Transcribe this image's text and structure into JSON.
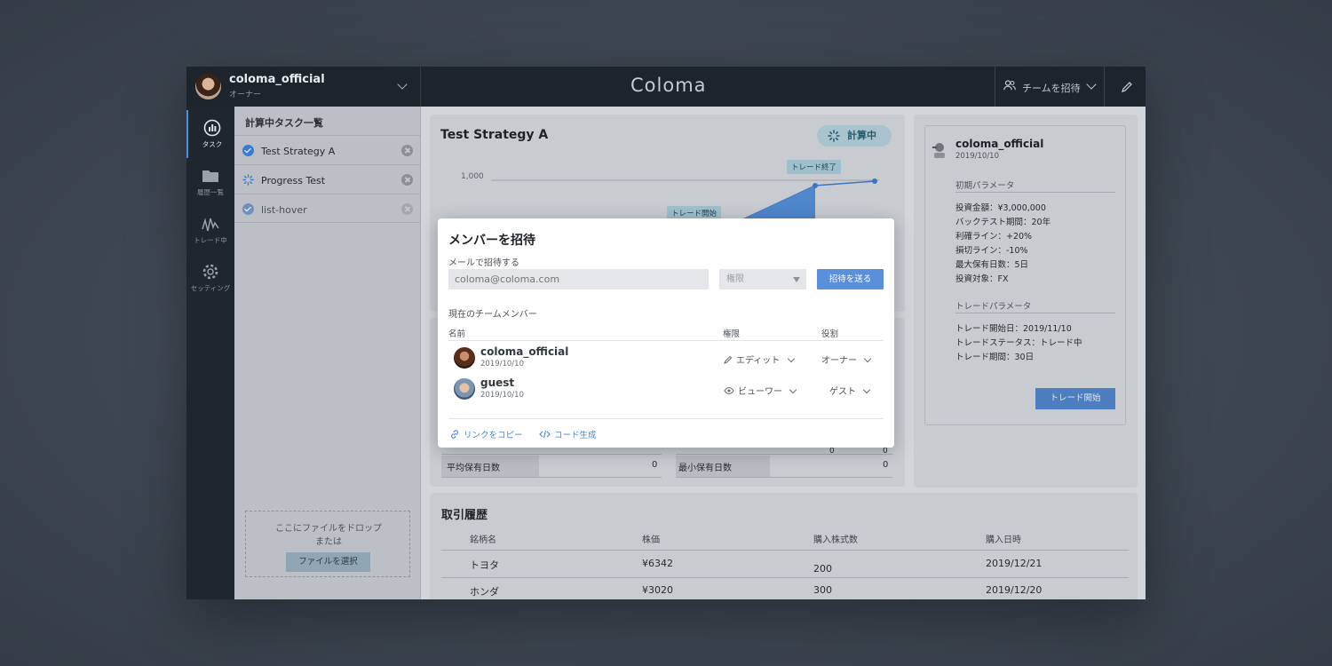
{
  "header": {
    "user_name": "coloma_official",
    "user_role": "オーナー",
    "logo": "Coloma",
    "invite_team_label": "チームを招待"
  },
  "sidebar": {
    "items": [
      {
        "label": "タスク",
        "icon": "chart-icon"
      },
      {
        "label": "履歴一覧",
        "icon": "folder-icon"
      },
      {
        "label": "トレード中",
        "icon": "pulse-icon"
      },
      {
        "label": "セッティング",
        "icon": "gear-icon"
      }
    ]
  },
  "tasks": {
    "title": "計算中タスク一覧",
    "items": [
      {
        "label": "Test Strategy A",
        "state": "done"
      },
      {
        "label": "Progress Test",
        "state": "loading"
      },
      {
        "label": "list-hover",
        "state": "done"
      }
    ],
    "drop_line1": "ここにファイルをドロップ",
    "drop_line2": "または",
    "drop_button": "ファイルを選択"
  },
  "strategy": {
    "title": "Test Strategy A",
    "status": "計算中",
    "y_tick": "1,000",
    "tag_end": "トレード終了",
    "tag_start": "トレード開始"
  },
  "right_panel": {
    "user_name": "coloma_official",
    "date": "2019/10/10",
    "initial_params_title": "初期パラメータ",
    "initial_params": [
      "投資金額：¥3,000,000",
      "バックテスト期間：20年",
      "利確ライン：+20%",
      "損切ライン：-10%",
      "最大保有日数：5日",
      "投資対象：FX"
    ],
    "trade_params_title": "トレードパラメータ",
    "trade_params": [
      "トレード開始日：2019/11/10",
      "トレードステータス：トレード中",
      "トレード期間：30日"
    ],
    "trade_button": "トレード開始"
  },
  "stats": {
    "avg_hold_label": "平均保有日数",
    "avg_hold_value": "0",
    "min_hold_label": "最小保有日数",
    "min_hold_value": "0",
    "partial_value_a": "0",
    "partial_value_b": "0"
  },
  "history": {
    "title": "取引履歴",
    "columns": [
      "銘柄名",
      "株価",
      "購入株式数",
      "購入日時"
    ],
    "rows": [
      [
        "トヨタ",
        "¥6342",
        "200",
        "2019/12/21"
      ],
      [
        "ホンダ",
        "¥3020",
        "300",
        "2019/12/20"
      ]
    ]
  },
  "modal": {
    "title": "メンバーを招待",
    "email_label": "メールで招待する",
    "email_placeholder": "coloma@coloma.com",
    "permission_placeholder": "権限",
    "send_button": "招待を送る",
    "members_title": "現在のチームメンバー",
    "col_name": "名前",
    "col_permission": "権限",
    "col_role": "役割",
    "members": [
      {
        "name": "coloma_official",
        "date": "2019/10/10",
        "permission": "エディット",
        "role": "オーナー"
      },
      {
        "name": "guest",
        "date": "2019/10/10",
        "permission": "ビューワー",
        "role": "ゲスト"
      }
    ],
    "copy_link": "リンクをコピー",
    "generate_code": "コード生成"
  }
}
